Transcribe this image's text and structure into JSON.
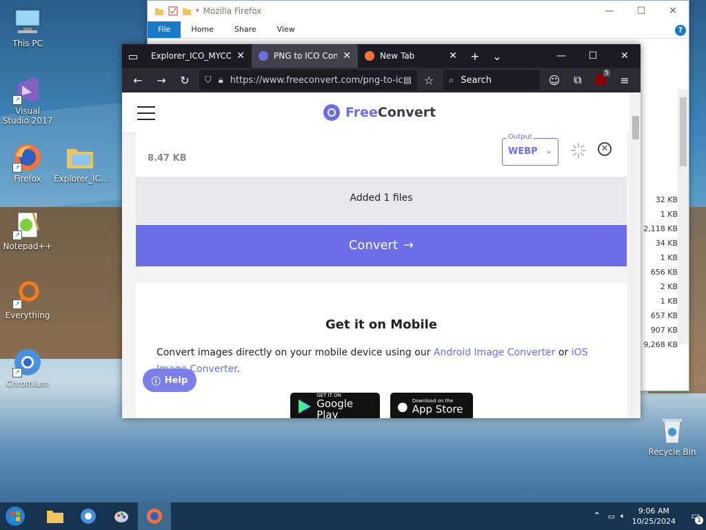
{
  "desktop": {
    "icons": [
      {
        "label": "This PC"
      },
      {
        "label": "Visual Studio 2017"
      },
      {
        "label": "Firefox"
      },
      {
        "label": "Explorer_IC..."
      },
      {
        "label": "Notepad++"
      },
      {
        "label": "Everything"
      },
      {
        "label": "Chromium"
      },
      {
        "label": "Recycle Bin"
      }
    ]
  },
  "explorer": {
    "title": "Mozilla Firefox",
    "ribbon_tabs": [
      "File",
      "Home",
      "Share",
      "View"
    ],
    "help": "?",
    "sizes": [
      "32 KB",
      "1 KB",
      "2,118 KB",
      "34 KB",
      "1 KB",
      "656 KB",
      "2 KB",
      "1 KB",
      "657 KB",
      "907 KB",
      "9,268 KB"
    ]
  },
  "firefox": {
    "tabs": [
      {
        "title": "Explorer_ICO_MYCOMPUTER",
        "active": false
      },
      {
        "title": "PNG to ICO Converter",
        "active": true
      },
      {
        "title": "New Tab",
        "active": false
      }
    ],
    "url": "https://www.freeconvert.com/png-to-ico",
    "search_placeholder": "Search",
    "extension_badge": "5"
  },
  "site": {
    "logo_free": "Free",
    "logo_convert": "Convert",
    "file_size": "8.47 KB",
    "output_label": "Output",
    "output_value": "WEBP",
    "added_text": "Added 1 files",
    "convert_label": "Convert",
    "mobile_title": "Get it on Mobile",
    "mobile_text_pre": "Convert images directly on your mobile device using our ",
    "android_link": "Android Image Converter",
    "mobile_text_or": " or ",
    "ios_link": "iOS Image Converter",
    "mobile_text_end": ".",
    "google_play_small": "GET IT ON",
    "google_play_big": "Google Play",
    "app_store_small": "Download on the",
    "app_store_big": "App Store",
    "help_label": "Help"
  },
  "taskbar": {
    "time": "9:06 AM",
    "date": "10/25/2024",
    "notification_count": "1"
  }
}
